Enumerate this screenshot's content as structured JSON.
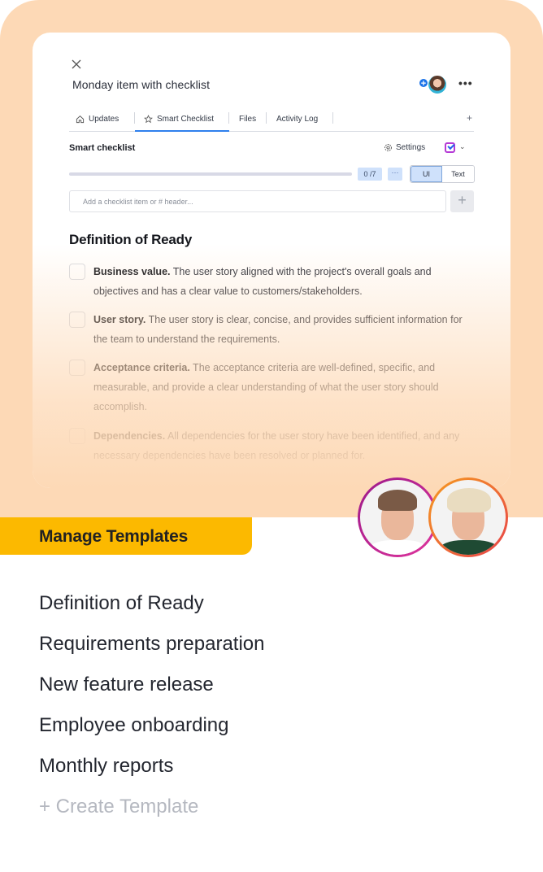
{
  "item": {
    "title": "Monday item with checklist",
    "more_label": "•••"
  },
  "tabs": [
    {
      "label": "Updates",
      "icon": "home-icon",
      "active": false
    },
    {
      "label": "Smart Checklist",
      "icon": "star-icon",
      "active": true
    },
    {
      "label": "Files",
      "active": false
    },
    {
      "label": "Activity Log",
      "active": false
    }
  ],
  "tabs_add_label": "+",
  "checklist": {
    "title": "Smart checklist",
    "settings_label": "Settings",
    "progress_count": "0 /7",
    "progress_fraction": 0,
    "more_label": "···",
    "view_modes": [
      {
        "label": "UI",
        "active": true
      },
      {
        "label": "Text",
        "active": false
      }
    ],
    "input_placeholder": "Add a checklist item or # header...",
    "add_label": "+",
    "section_title": "Definition of Ready",
    "items": [
      {
        "bold": "Business value.",
        "text": " The user story aligned with the project's overall goals and objectives and has a clear value to customers/stakeholders.",
        "checked": false
      },
      {
        "bold": "User story.",
        "text": " The user story is clear, concise, and provides sufficient information for the team to understand the requirements.",
        "checked": false
      },
      {
        "bold": "Acceptance criteria.",
        "text": " The acceptance criteria are well-defined, specific, and measurable, and provide a clear understanding of what the user story should accomplish.",
        "checked": false
      },
      {
        "bold": "Dependencies.",
        "text": " All dependencies for the user story have been identified, and any necessary dependencies have been resolved or planned for.",
        "checked": false
      }
    ]
  },
  "manage": {
    "label": "Manage Templates"
  },
  "templates": [
    "Definition of Ready",
    "Requirements preparation",
    "New feature release",
    "Employee onboarding",
    "Monthly reports"
  ],
  "create_template_label": "+ Create Template",
  "colors": {
    "peach": "#fdd9b6",
    "accent_yellow": "#fcb900",
    "active_tab": "#2f80ed",
    "badge_blue": "#cfe1fb"
  }
}
